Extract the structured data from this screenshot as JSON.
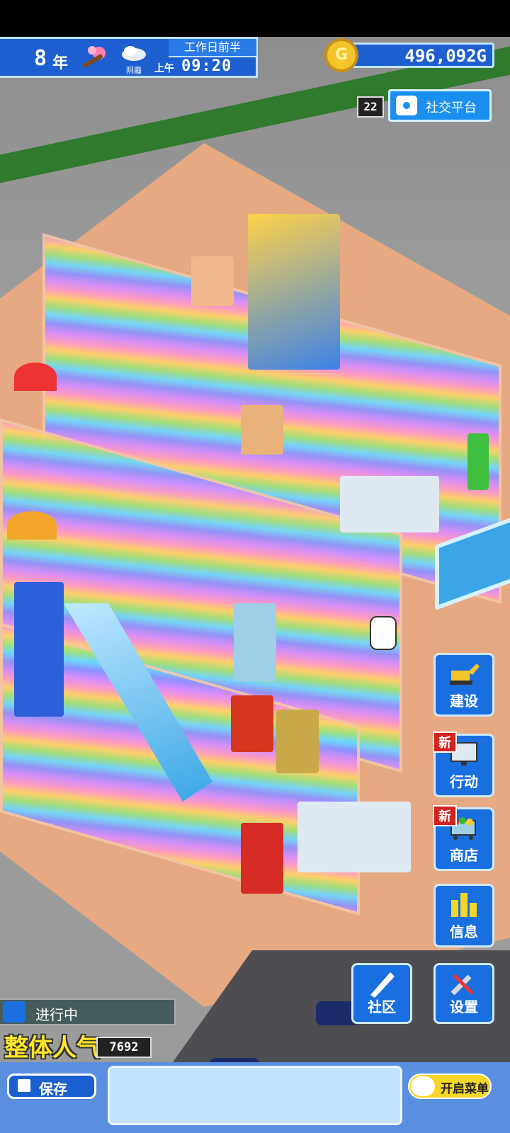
{
  "hud": {
    "year_number": "8",
    "year_unit": "年",
    "season": "spring-blossom-icon",
    "weather": "cloudy-icon",
    "weather_label": "阴霾",
    "period": "工作日前半",
    "ampm": "上午",
    "time": "09:20",
    "money": "496,092G",
    "coin_symbol": "G"
  },
  "social": {
    "count": "22",
    "label": "社交平台",
    "icon": "camera-icon"
  },
  "right_menu": [
    {
      "label": "建设",
      "icon": "excavator-icon",
      "new": ""
    },
    {
      "label": "行动",
      "icon": "monitor-icon",
      "new": "新"
    },
    {
      "label": "商店",
      "icon": "shopping-cart-icon",
      "new": "新"
    },
    {
      "label": "信息",
      "icon": "bar-chart-icon",
      "new": ""
    }
  ],
  "community_label": "社区",
  "settings_label": "设置",
  "status": {
    "progress_label": "进行中",
    "popularity_label": "整体人气",
    "popularity_value": "7692"
  },
  "bottom": {
    "save_label": "保存",
    "menu_toggle_label": "开启菜单"
  },
  "colors": {
    "hud_blue": "#1d5fd0",
    "button_blue": "#1a6fe0",
    "accent_yellow": "#f4d726",
    "new_red": "#d3221f"
  }
}
